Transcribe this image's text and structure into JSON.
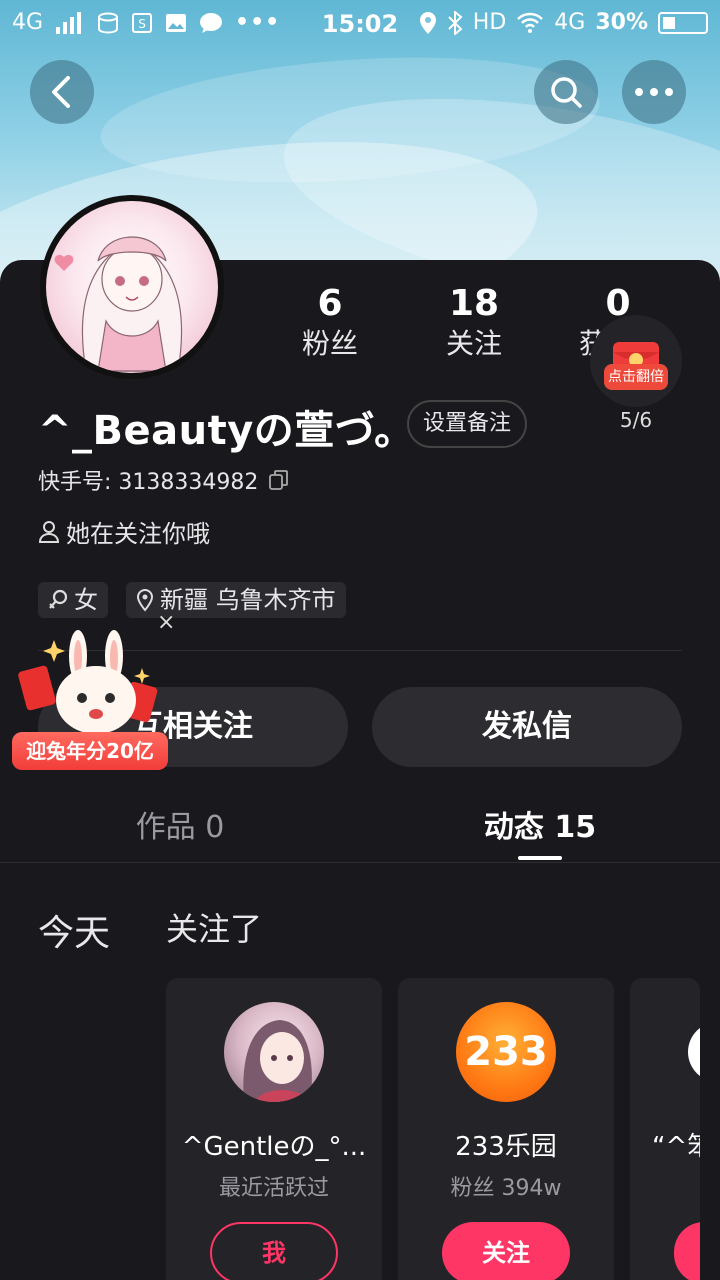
{
  "status_bar": {
    "network": "4G",
    "time": "15:02",
    "hd": "HD",
    "network_right": "4G",
    "battery": "30%"
  },
  "profile": {
    "stats": [
      {
        "num": "6",
        "label": "粉丝"
      },
      {
        "num": "18",
        "label": "关注"
      },
      {
        "num": "0",
        "label": "获"
      }
    ],
    "redpack_label": "点击翻倍",
    "redpack_count": "5/6",
    "name": "^_Beautyの萱づ。",
    "remark_button": "设置备注",
    "kuaishou_id": "快手号: 3138334982",
    "follow_hint": "她在关注你哦",
    "gender_tag": "女",
    "location_tag": "新疆 乌鲁木齐市",
    "close_mark": "×"
  },
  "actions": {
    "mutual_follow": "互相关注",
    "message": "发私信",
    "promo_badge": "迎兔年分20亿"
  },
  "tabs": [
    {
      "label": "作品 0"
    },
    {
      "label": "动态 15"
    }
  ],
  "feed": {
    "day": "今天",
    "action": "关注了",
    "cards": [
      {
        "name": "^Gentleの_°...",
        "sub": "最近活跃过",
        "button": "我"
      },
      {
        "name": "233乐园",
        "sub": "粉丝 394w",
        "button": "关注",
        "avatar_text": "233"
      },
      {
        "name": "“^笨"
      }
    ]
  },
  "colors": {
    "accent": "#fe3666",
    "background": "#18181d",
    "card": "#232328"
  }
}
